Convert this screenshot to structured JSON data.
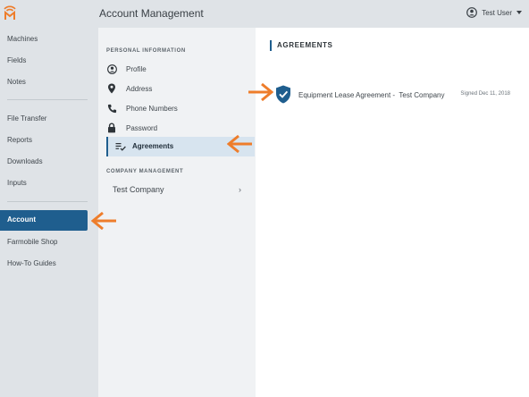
{
  "header": {
    "title": "Account Management",
    "user_name": "Test User"
  },
  "sidebar": {
    "items": [
      {
        "label": "Machines"
      },
      {
        "label": "Fields"
      },
      {
        "label": "Notes"
      },
      {
        "label": "File Transfer"
      },
      {
        "label": "Reports"
      },
      {
        "label": "Downloads"
      },
      {
        "label": "Inputs"
      },
      {
        "label": "Account",
        "active": true
      },
      {
        "label": "Farmobile Shop"
      },
      {
        "label": "How-To Guides"
      }
    ]
  },
  "subnav": {
    "personal_title": "PERSONAL INFORMATION",
    "personal_items": [
      {
        "label": "Profile",
        "icon": "person-circle-icon"
      },
      {
        "label": "Address",
        "icon": "location-pin-icon"
      },
      {
        "label": "Phone Numbers",
        "icon": "phone-icon"
      },
      {
        "label": "Password",
        "icon": "lock-icon"
      },
      {
        "label": "Agreements",
        "icon": "list-check-icon",
        "active": true
      }
    ],
    "company_title": "COMPANY MANAGEMENT",
    "company_items": [
      {
        "label": "Test Company",
        "icon": "chevron-right-icon"
      }
    ]
  },
  "main": {
    "title": "AGREEMENTS",
    "agreements": [
      {
        "name": "Equipment Lease Agreement -  Test Company",
        "signed": "Signed Dec 11, 2018",
        "icon": "shield-check-icon"
      }
    ]
  },
  "colors": {
    "accent": "#1f5e8e",
    "annotation_arrow": "#ee7d2b",
    "sidebar_bg": "#dfe3e7",
    "subnav_bg": "#f0f2f4",
    "active_subnav_bg": "#d7e4ef"
  }
}
